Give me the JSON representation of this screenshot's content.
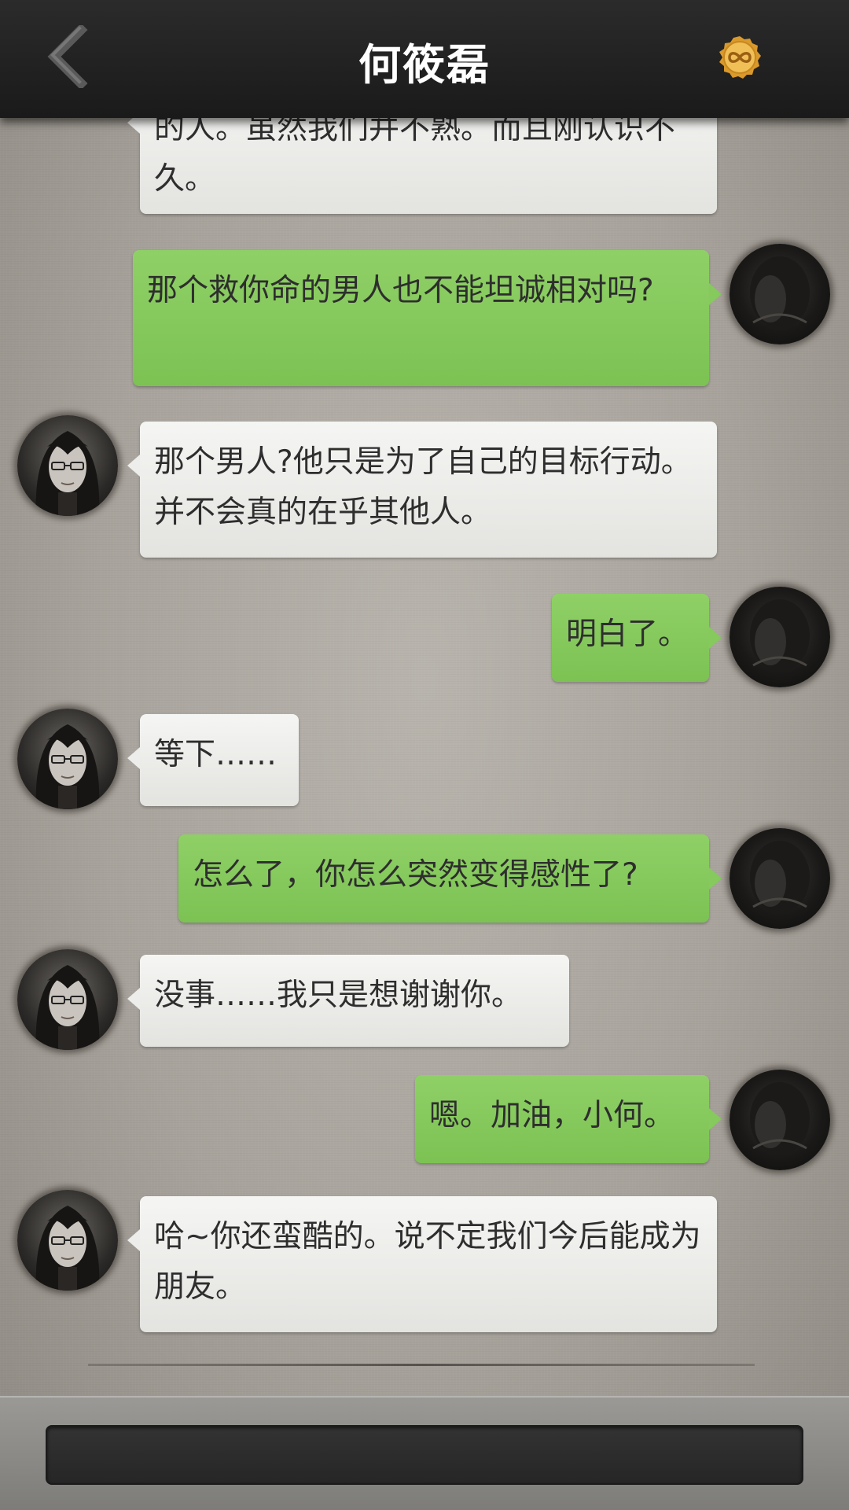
{
  "header": {
    "title": "何筱磊",
    "back_icon": "chevron-left-icon",
    "coin_icon": "infinity-coin-icon"
  },
  "colors": {
    "header_bg": "#1f1f1f",
    "user_bubble": "#86c95c",
    "char_bubble": "#ededeb",
    "coin": "#e0a93a"
  },
  "messages": [
    {
      "sender": "character",
      "text": "的人。虽然我们并不熟。而且刚认识不久。"
    },
    {
      "sender": "user",
      "text": "那个救你命的男人也不能坦诚相对吗?"
    },
    {
      "sender": "character",
      "text": "那个男人?他只是为了自己的目标行动。并不会真的在乎其他人。"
    },
    {
      "sender": "user",
      "text": "明白了。"
    },
    {
      "sender": "character",
      "text": "等下……"
    },
    {
      "sender": "user",
      "text": "怎么了，你怎么突然变得感性了?"
    },
    {
      "sender": "character",
      "text": "没事……我只是想谢谢你。"
    },
    {
      "sender": "user",
      "text": "嗯。加油，小何。"
    },
    {
      "sender": "character",
      "text": "哈~你还蛮酷的。说不定我们今后能成为朋友。"
    }
  ],
  "input": {
    "value": ""
  }
}
